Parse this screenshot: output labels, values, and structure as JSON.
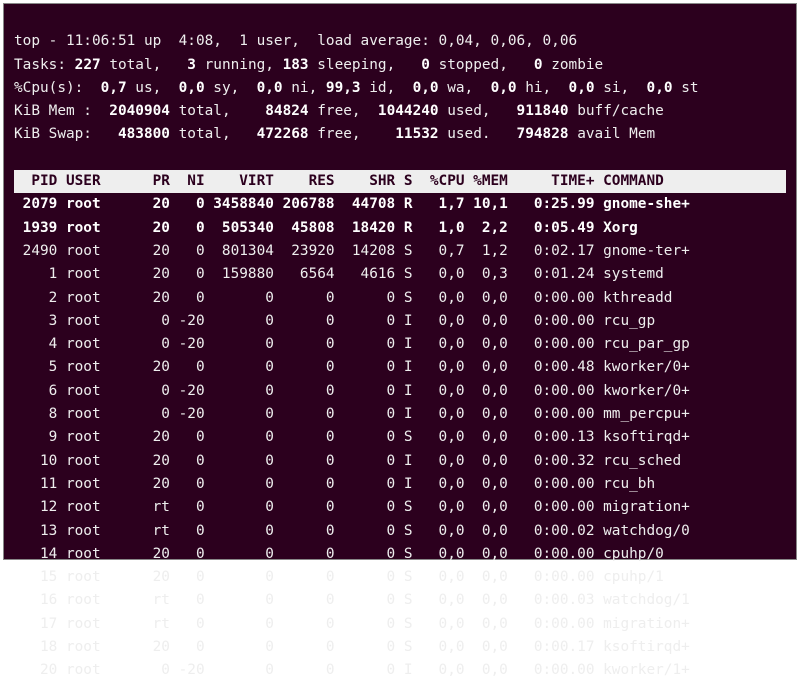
{
  "summary": {
    "l1_a": "top - 11:06:51 up  4:08,  1 user,  load average: 0,04, 0,06, 0,06",
    "l2_a": "Tasks: ",
    "l2_b": "227 ",
    "l2_c": "total,   ",
    "l2_d": "3 ",
    "l2_e": "running, ",
    "l2_f": "183 ",
    "l2_g": "sleeping,   ",
    "l2_h": "0 ",
    "l2_i": "stopped,   ",
    "l2_j": "0 ",
    "l2_k": "zombie",
    "l3_a": "%Cpu(s):  ",
    "l3_b": "0,7 ",
    "l3_c": "us,  ",
    "l3_d": "0,0 ",
    "l3_e": "sy,  ",
    "l3_f": "0,0 ",
    "l3_g": "ni, ",
    "l3_h": "99,3 ",
    "l3_i": "id,  ",
    "l3_j": "0,0 ",
    "l3_k": "wa,  ",
    "l3_l": "0,0 ",
    "l3_m": "hi,  ",
    "l3_n": "0,0 ",
    "l3_o": "si,  ",
    "l3_p": "0,0 ",
    "l3_q": "st",
    "l4_a": "KiB Mem : ",
    "l4_b": " 2040904 ",
    "l4_c": "total,   ",
    "l4_d": " 84824 ",
    "l4_e": "free,  ",
    "l4_f": "1044240 ",
    "l4_g": "used,   ",
    "l4_h": "911840 ",
    "l4_i": "buff/cache",
    "l5_a": "KiB Swap:  ",
    "l5_b": " 483800 ",
    "l5_c": "total,   ",
    "l5_d": "472268 ",
    "l5_e": "free,    ",
    "l5_f": "11532 ",
    "l5_g": "used.   ",
    "l5_h": "794828 ",
    "l5_i": "avail Mem"
  },
  "header": "  PID USER      PR  NI    VIRT    RES    SHR S  %CPU %MEM     TIME+ COMMAND    ",
  "rows": [
    {
      "pid": " 2079",
      "user": "root",
      "pr": "20",
      "ni": "  0",
      "virt": "3458840",
      "res": "206788",
      "shr": " 44708",
      "s": "R",
      "cpu": " 1,7",
      "mem": "10,1",
      "time": "  0:25.99",
      "cmd": "gnome-she+",
      "bold": true
    },
    {
      "pid": " 1939",
      "user": "root",
      "pr": "20",
      "ni": "  0",
      "virt": " 505340",
      "res": " 45808",
      "shr": " 18420",
      "s": "R",
      "cpu": " 1,0",
      "mem": " 2,2",
      "time": "  0:05.49",
      "cmd": "Xorg",
      "bold": true
    },
    {
      "pid": " 2490",
      "user": "root",
      "pr": "20",
      "ni": "  0",
      "virt": " 801304",
      "res": " 23920",
      "shr": " 14208",
      "s": "S",
      "cpu": " 0,7",
      "mem": " 1,2",
      "time": "  0:02.17",
      "cmd": "gnome-ter+",
      "bold": false
    },
    {
      "pid": "    1",
      "user": "root",
      "pr": "20",
      "ni": "  0",
      "virt": " 159880",
      "res": "  6564",
      "shr": "  4616",
      "s": "S",
      "cpu": " 0,0",
      "mem": " 0,3",
      "time": "  0:01.24",
      "cmd": "systemd",
      "bold": false
    },
    {
      "pid": "    2",
      "user": "root",
      "pr": "20",
      "ni": "  0",
      "virt": "      0",
      "res": "     0",
      "shr": "     0",
      "s": "S",
      "cpu": " 0,0",
      "mem": " 0,0",
      "time": "  0:00.00",
      "cmd": "kthreadd",
      "bold": false
    },
    {
      "pid": "    3",
      "user": "root",
      "pr": " 0",
      "ni": "-20",
      "virt": "      0",
      "res": "     0",
      "shr": "     0",
      "s": "I",
      "cpu": " 0,0",
      "mem": " 0,0",
      "time": "  0:00.00",
      "cmd": "rcu_gp",
      "bold": false
    },
    {
      "pid": "    4",
      "user": "root",
      "pr": " 0",
      "ni": "-20",
      "virt": "      0",
      "res": "     0",
      "shr": "     0",
      "s": "I",
      "cpu": " 0,0",
      "mem": " 0,0",
      "time": "  0:00.00",
      "cmd": "rcu_par_gp",
      "bold": false
    },
    {
      "pid": "    5",
      "user": "root",
      "pr": "20",
      "ni": "  0",
      "virt": "      0",
      "res": "     0",
      "shr": "     0",
      "s": "I",
      "cpu": " 0,0",
      "mem": " 0,0",
      "time": "  0:00.48",
      "cmd": "kworker/0+",
      "bold": false
    },
    {
      "pid": "    6",
      "user": "root",
      "pr": " 0",
      "ni": "-20",
      "virt": "      0",
      "res": "     0",
      "shr": "     0",
      "s": "I",
      "cpu": " 0,0",
      "mem": " 0,0",
      "time": "  0:00.00",
      "cmd": "kworker/0+",
      "bold": false
    },
    {
      "pid": "    8",
      "user": "root",
      "pr": " 0",
      "ni": "-20",
      "virt": "      0",
      "res": "     0",
      "shr": "     0",
      "s": "I",
      "cpu": " 0,0",
      "mem": " 0,0",
      "time": "  0:00.00",
      "cmd": "mm_percpu+",
      "bold": false
    },
    {
      "pid": "    9",
      "user": "root",
      "pr": "20",
      "ni": "  0",
      "virt": "      0",
      "res": "     0",
      "shr": "     0",
      "s": "S",
      "cpu": " 0,0",
      "mem": " 0,0",
      "time": "  0:00.13",
      "cmd": "ksoftirqd+",
      "bold": false
    },
    {
      "pid": "   10",
      "user": "root",
      "pr": "20",
      "ni": "  0",
      "virt": "      0",
      "res": "     0",
      "shr": "     0",
      "s": "I",
      "cpu": " 0,0",
      "mem": " 0,0",
      "time": "  0:00.32",
      "cmd": "rcu_sched",
      "bold": false
    },
    {
      "pid": "   11",
      "user": "root",
      "pr": "20",
      "ni": "  0",
      "virt": "      0",
      "res": "     0",
      "shr": "     0",
      "s": "I",
      "cpu": " 0,0",
      "mem": " 0,0",
      "time": "  0:00.00",
      "cmd": "rcu_bh",
      "bold": false
    },
    {
      "pid": "   12",
      "user": "root",
      "pr": "rt",
      "ni": "  0",
      "virt": "      0",
      "res": "     0",
      "shr": "     0",
      "s": "S",
      "cpu": " 0,0",
      "mem": " 0,0",
      "time": "  0:00.00",
      "cmd": "migration+",
      "bold": false
    },
    {
      "pid": "   13",
      "user": "root",
      "pr": "rt",
      "ni": "  0",
      "virt": "      0",
      "res": "     0",
      "shr": "     0",
      "s": "S",
      "cpu": " 0,0",
      "mem": " 0,0",
      "time": "  0:00.02",
      "cmd": "watchdog/0",
      "bold": false
    },
    {
      "pid": "   14",
      "user": "root",
      "pr": "20",
      "ni": "  0",
      "virt": "      0",
      "res": "     0",
      "shr": "     0",
      "s": "S",
      "cpu": " 0,0",
      "mem": " 0,0",
      "time": "  0:00.00",
      "cmd": "cpuhp/0",
      "bold": false
    },
    {
      "pid": "   15",
      "user": "root",
      "pr": "20",
      "ni": "  0",
      "virt": "      0",
      "res": "     0",
      "shr": "     0",
      "s": "S",
      "cpu": " 0,0",
      "mem": " 0,0",
      "time": "  0:00.00",
      "cmd": "cpuhp/1",
      "bold": false
    },
    {
      "pid": "   16",
      "user": "root",
      "pr": "rt",
      "ni": "  0",
      "virt": "      0",
      "res": "     0",
      "shr": "     0",
      "s": "S",
      "cpu": " 0,0",
      "mem": " 0,0",
      "time": "  0:00.03",
      "cmd": "watchdog/1",
      "bold": false
    },
    {
      "pid": "   17",
      "user": "root",
      "pr": "rt",
      "ni": "  0",
      "virt": "      0",
      "res": "     0",
      "shr": "     0",
      "s": "S",
      "cpu": " 0,0",
      "mem": " 0,0",
      "time": "  0:00.00",
      "cmd": "migration+",
      "bold": false
    },
    {
      "pid": "   18",
      "user": "root",
      "pr": "20",
      "ni": "  0",
      "virt": "      0",
      "res": "     0",
      "shr": "     0",
      "s": "S",
      "cpu": " 0,0",
      "mem": " 0,0",
      "time": "  0:00.17",
      "cmd": "ksoftirqd+",
      "bold": false
    },
    {
      "pid": "   20",
      "user": "root",
      "pr": " 0",
      "ni": "-20",
      "virt": "      0",
      "res": "     0",
      "shr": "     0",
      "s": "I",
      "cpu": " 0,0",
      "mem": " 0,0",
      "time": "  0:00.00",
      "cmd": "kworker/1+",
      "bold": false
    }
  ]
}
